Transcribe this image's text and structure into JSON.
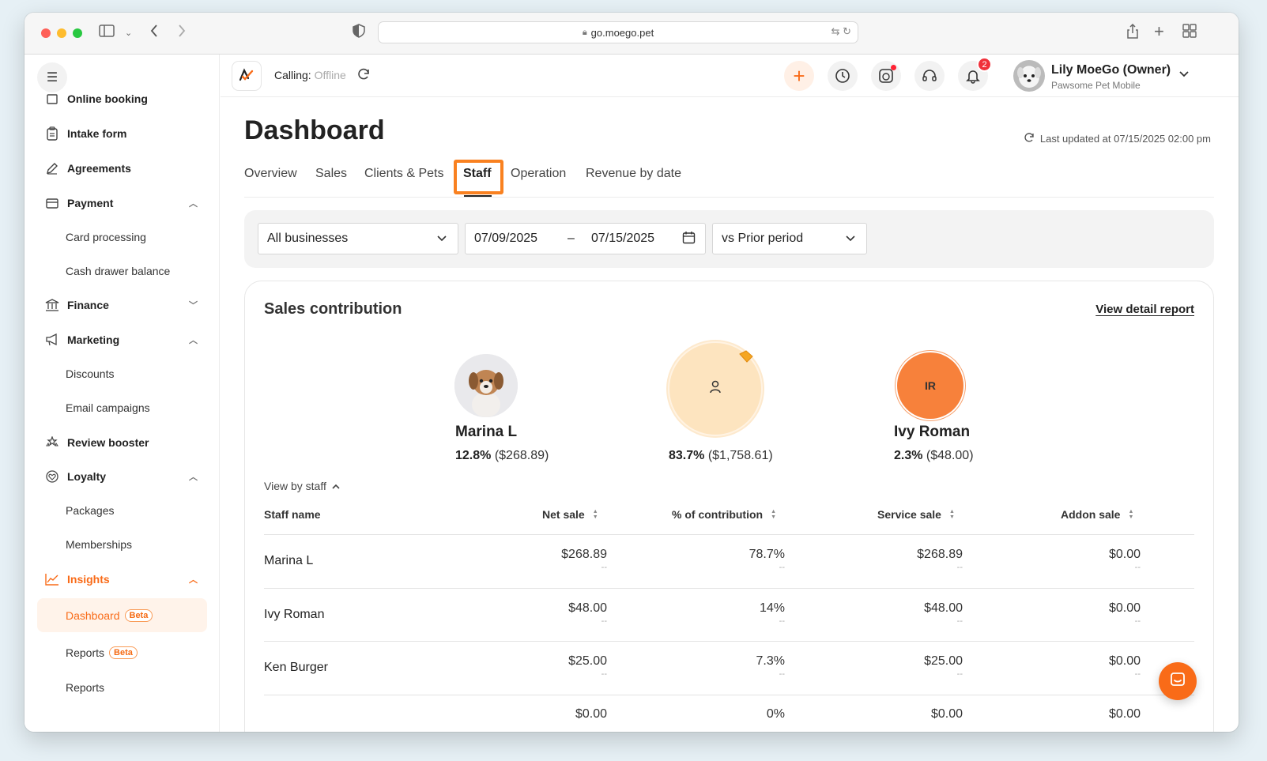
{
  "browser": {
    "url": "go.moego.pet"
  },
  "sidebar": {
    "items": [
      {
        "label": "Online booking",
        "icon": "online-booking-icon"
      },
      {
        "label": "Intake form",
        "icon": "clipboard-icon"
      },
      {
        "label": "Agreements",
        "icon": "pen-icon"
      },
      {
        "label": "Payment",
        "icon": "payment-icon"
      },
      {
        "label": "Card processing"
      },
      {
        "label": "Cash drawer balance"
      },
      {
        "label": "Finance",
        "icon": "bank-icon"
      },
      {
        "label": "Marketing",
        "icon": "megaphone-icon"
      },
      {
        "label": "Discounts"
      },
      {
        "label": "Email campaigns"
      },
      {
        "label": "Review booster",
        "icon": "stars-icon"
      },
      {
        "label": "Loyalty",
        "icon": "loyalty-icon"
      },
      {
        "label": "Packages"
      },
      {
        "label": "Memberships"
      },
      {
        "label": "Insights",
        "icon": "chart-line-icon"
      },
      {
        "label": "Dashboard",
        "badge": "Beta"
      },
      {
        "label": "Reports",
        "badge": "Beta"
      },
      {
        "label": "Reports"
      }
    ]
  },
  "topbar": {
    "calling_label": "Calling:",
    "calling_status": "Offline",
    "notification_count": "2",
    "user_name": "Lily MoeGo (Owner)",
    "business_name": "Pawsome Pet Mobile"
  },
  "page": {
    "title": "Dashboard",
    "last_updated": "Last updated at 07/15/2025 02:00 pm",
    "tabs": [
      "Overview",
      "Sales",
      "Clients & Pets",
      "Staff",
      "Operation",
      "Revenue by date"
    ],
    "active_tab": "Staff"
  },
  "filters": {
    "business": "All businesses",
    "date_start": "07/09/2025",
    "date_sep": "–",
    "date_end": "07/15/2025",
    "compare": "vs Prior period"
  },
  "card": {
    "title": "Sales contribution",
    "detail_link": "View detail report",
    "top_staff": [
      {
        "name": "Marina L",
        "pct": "12.8%",
        "amount": "($268.89)"
      },
      {
        "name": "",
        "pct": "83.7%",
        "amount": "($1,758.61)"
      },
      {
        "name": "Ivy Roman",
        "initials": "IR",
        "pct": "2.3%",
        "amount": "($48.00)"
      }
    ],
    "view_by": "View by staff",
    "columns": [
      "Staff name",
      "Net sale",
      "% of contribution",
      "Service sale",
      "Addon sale"
    ],
    "rows": [
      {
        "name": "Marina L",
        "net": "$268.89",
        "pct": "78.7%",
        "service": "$268.89",
        "addon": "$0.00",
        "sub": "--"
      },
      {
        "name": "Ivy Roman",
        "net": "$48.00",
        "pct": "14%",
        "service": "$48.00",
        "addon": "$0.00",
        "sub": "--"
      },
      {
        "name": "Ken Burger",
        "net": "$25.00",
        "pct": "7.3%",
        "service": "$25.00",
        "addon": "$0.00",
        "sub": "--"
      },
      {
        "name": "",
        "net": "$0.00",
        "pct": "0%",
        "service": "$0.00",
        "addon": "$0.00",
        "sub": ""
      }
    ]
  },
  "colors": {
    "accent": "#f96b18",
    "highlight": "#f98120"
  }
}
